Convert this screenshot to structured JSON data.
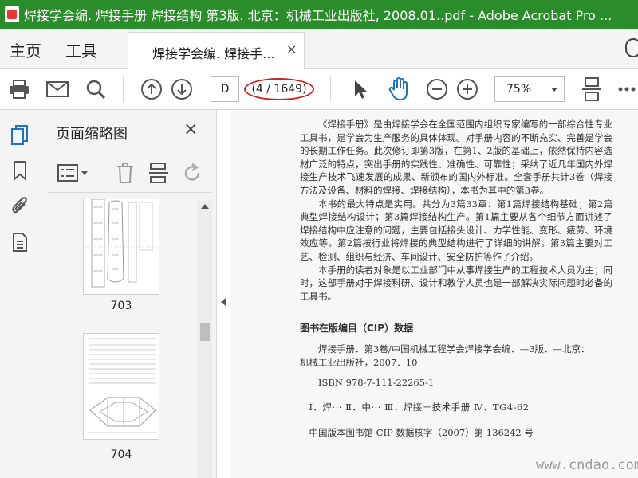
{
  "window": {
    "title": "焊接学会编. 焊接手册 焊接结构 第3版. 北京：机械工业出版社, 2008.01..pdf - Adobe Acrobat Pro ..."
  },
  "menu": {
    "home": "主页",
    "tools": "工具"
  },
  "document_tab": {
    "label": "焊接学会编. 焊接手...",
    "close": "×"
  },
  "toolbar": {
    "page_input": "D",
    "page_count": "(4 / 1649)",
    "zoom": "75%",
    "icons": [
      "print-icon",
      "email-icon",
      "search-icon",
      "page-up-icon",
      "page-down-icon",
      "select-cursor-icon",
      "hand-icon",
      "zoom-out-icon",
      "zoom-in-icon",
      "fit-page-icon",
      "more-icon"
    ]
  },
  "left_rail": {
    "icons": [
      "page-thumbnails-icon",
      "bookmarks-icon",
      "attachments-icon",
      "document-icon"
    ]
  },
  "thumbnail_panel": {
    "title": "页面缩略图",
    "close": "×",
    "tools": [
      "options-menu-icon",
      "delete-icon",
      "insert-page-icon",
      "rotate-icon"
    ],
    "pages": [
      {
        "label": "703"
      },
      {
        "label": "704"
      }
    ]
  },
  "document": {
    "paragraphs": [
      "《焊接手册》是由焊接学会在全国范围内组织专家编写的一部综合性专业工具书，是学会为生产服务的具体体现。对手册内容的不断充实、完善是学会的长期工作任务。此次修订即第3版，在第1、2版的基础上，依然保持内容选材广泛的特点，突出手册的实践性、准确性、可靠性；采纳了近几年国内外焊接生产技术飞速发展的成果、新颁布的国内外标准。全套手册共计3卷（焊接方法及设备、材料的焊接、焊接结构），本书为其中的第3卷。",
      "本书的最大特点是实用。共分为3篇33章：第1篇焊接结构基础；第2篇典型焊接结构设计；第3篇焊接结构生产。第1篇主要从各个细节方面讲述了焊接结构中应注意的问题，主要包括接头设计、力学性能、变形、疲劳、环境效应等。第2篇按行业将焊接的典型结构进行了详细的讲解。第3篇主要对工艺、检测、组织与经济、车间设计、安全防护等作了介绍。",
      "本手册的读者对象是以工业部门中从事焊接生产的工程技术人员为主；同时，这部手册对于焊接科研、设计和教学人员也是一部解决实际问题时必备的工具书。"
    ],
    "cip_heading": "图书在版编目（CIP）数据",
    "cip_line1": "焊接手册．第3卷/中国机械工程学会焊接学会编．—3版．—北京：",
    "cip_line1b": "机械工业出版社，2007．10",
    "cip_isbn": "ISBN 978-7-111-22265-1",
    "cip_class": "Ⅰ．焊···  Ⅱ．中···  Ⅲ．焊接－技术手册  Ⅳ．TG4-62",
    "cip_data_no": "中国版本图书馆 CIP 数据核字（2007）第 136242 号"
  },
  "watermark": "www.cndao.com"
}
